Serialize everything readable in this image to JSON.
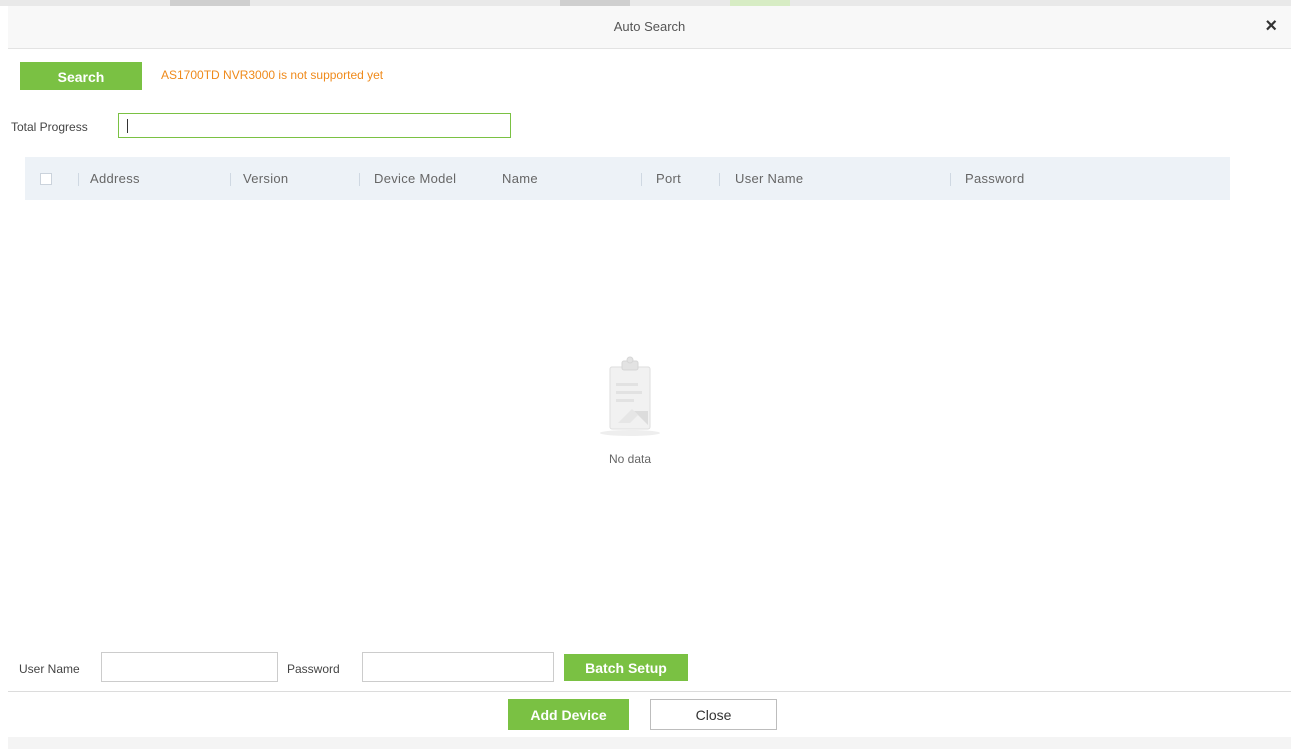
{
  "dialog": {
    "title": "Auto Search",
    "close_symbol": "×"
  },
  "toolbar": {
    "search_label": "Search",
    "warning": "AS1700TD NVR3000 is not supported yet"
  },
  "progress": {
    "label": "Total Progress",
    "value": ""
  },
  "table": {
    "columns": [
      "Address",
      "Version",
      "Device Model",
      "Name",
      "Port",
      "User Name",
      "Password"
    ],
    "rows": [],
    "empty_text": "No data"
  },
  "batch": {
    "username_label": "User Name",
    "username_value": "",
    "password_label": "Password",
    "password_value": "",
    "batch_setup_label": "Batch Setup"
  },
  "footer": {
    "add_device_label": "Add Device",
    "close_label": "Close"
  },
  "icons": {
    "close": "close-icon",
    "select_all": "checkbox-icon",
    "empty": "clipboard-icon"
  },
  "colors": {
    "accent": "#7ac143",
    "warning": "#ef8a1b",
    "header_bg": "#edf2f7"
  }
}
